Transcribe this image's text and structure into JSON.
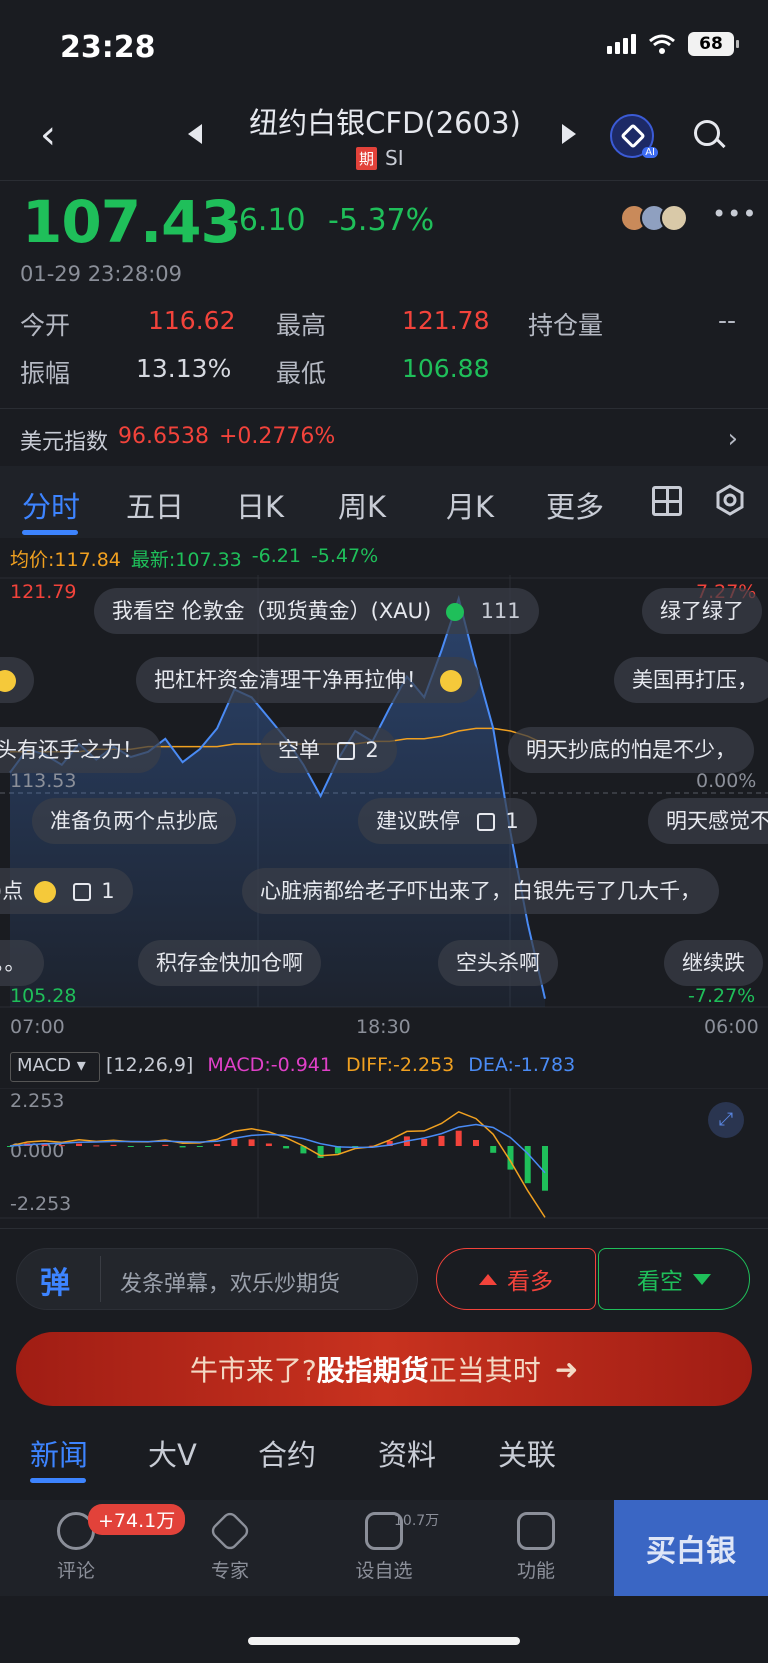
{
  "status_bar": {
    "time": "23:28",
    "battery": "68"
  },
  "header": {
    "title": "纽约白银CFD(2603)",
    "badge": "期",
    "code": "SI"
  },
  "quote": {
    "price": "107.43",
    "change": "-6.10",
    "change_pct": "-5.37%",
    "timestamp": "01-29 23:28:09",
    "open_label": "今开",
    "open": "116.62",
    "high_label": "最高",
    "high": "121.78",
    "oi_label": "持仓量",
    "oi": "--",
    "amplitude_label": "振幅",
    "amplitude": "13.13%",
    "low_label": "最低",
    "low": "106.88"
  },
  "dollar_index": {
    "label": "美元指数",
    "value": "96.6538",
    "change": "+0.2776%"
  },
  "tabs": [
    "分时",
    "五日",
    "日K",
    "周K",
    "月K",
    "更多"
  ],
  "chart_info": {
    "avg": "均价:117.84",
    "latest": "最新:107.33",
    "chg": "-6.21",
    "pct": "-5.47%"
  },
  "axis": {
    "y_top": "121.79",
    "y_mid": "113.53",
    "y_bot": "105.28",
    "pct_top": "7.27%",
    "pct_mid": "0.00%",
    "pct_bot": "-7.27%",
    "x": [
      "07:00",
      "18:30",
      "06:00"
    ]
  },
  "danmaku": [
    "我看空 伦敦金（现货黄金）(XAU)",
    "111",
    "绿了绿了",
    "把杠杆资金清理干净再拉伸！",
    "美国再打压，",
    "头有还手之力！",
    "空单",
    "2",
    "明天抄底的怕是不少，",
    "准备负两个点抄底",
    "建议跌停",
    "1",
    "明天感觉不",
    ")点",
    "1",
    "心脏病都给老子吓出来了，白银先亏了几大千，",
    "。。",
    "积存金快加仓啊",
    "空头杀啊",
    "继续跌"
  ],
  "macd": {
    "selector": "MACD",
    "params": "[12,26,9]",
    "macd": "MACD:-0.941",
    "diff": "DIFF:-2.253",
    "dea": "DEA:-1.783",
    "y_top": "2.253",
    "y_mid": "0.000",
    "y_bot": "-2.253"
  },
  "actions": {
    "danmu_placeholder": "发条弹幕，欢乐炒期货",
    "danmu_icon": "弹",
    "bull": "看多",
    "bear": "看空"
  },
  "banner": {
    "part1": "牛市来了?",
    "part2": "股指期货",
    "part3": "正当其时",
    "arrow": "➜"
  },
  "news_tabs": [
    "新闻",
    "大V",
    "合约",
    "资料",
    "关联"
  ],
  "bottom_nav": {
    "comment": "评论",
    "comment_badge": "+74.1万",
    "expert": "专家",
    "watchlist": "设自选",
    "watchlist_count": "10.7万",
    "function": "功能",
    "buy": "买白银"
  },
  "colors": {
    "up": "#f2433b",
    "down": "#1fbf5a",
    "accent": "#3d84ff",
    "price_line": "#4a8bf5",
    "avg_line": "#f0a020"
  },
  "chart_data": {
    "type": "line",
    "title": "",
    "x_ticks": [
      "07:00",
      "18:30",
      "06:00"
    ],
    "ylim": [
      105.28,
      121.79
    ],
    "series": [
      {
        "values": [
          114.3,
          115.2,
          115.0,
          114.6,
          115.4,
          114.8,
          115.3,
          114.9,
          115.1,
          115.6,
          114.7,
          115.2,
          116.0,
          117.5,
          117.2,
          116.4,
          115.6,
          114.6,
          113.4,
          114.8,
          115.9,
          115.5,
          116.8,
          118.0,
          117.2,
          119.0,
          121.0,
          118.4,
          116.0,
          112.0,
          108.5,
          105.6
        ]
      },
      {
        "values": [
          115.1,
          115.1,
          115.1,
          115.1,
          115.1,
          115.2,
          115.2,
          115.2,
          115.3,
          115.3,
          115.3,
          115.3,
          115.3,
          115.4,
          115.4,
          115.4,
          115.4,
          115.4,
          115.4,
          115.4,
          115.4,
          115.5,
          115.5,
          115.6,
          115.6,
          115.7,
          115.9,
          116.0,
          116.0,
          115.9,
          115.7,
          115.4
        ]
      }
    ]
  }
}
